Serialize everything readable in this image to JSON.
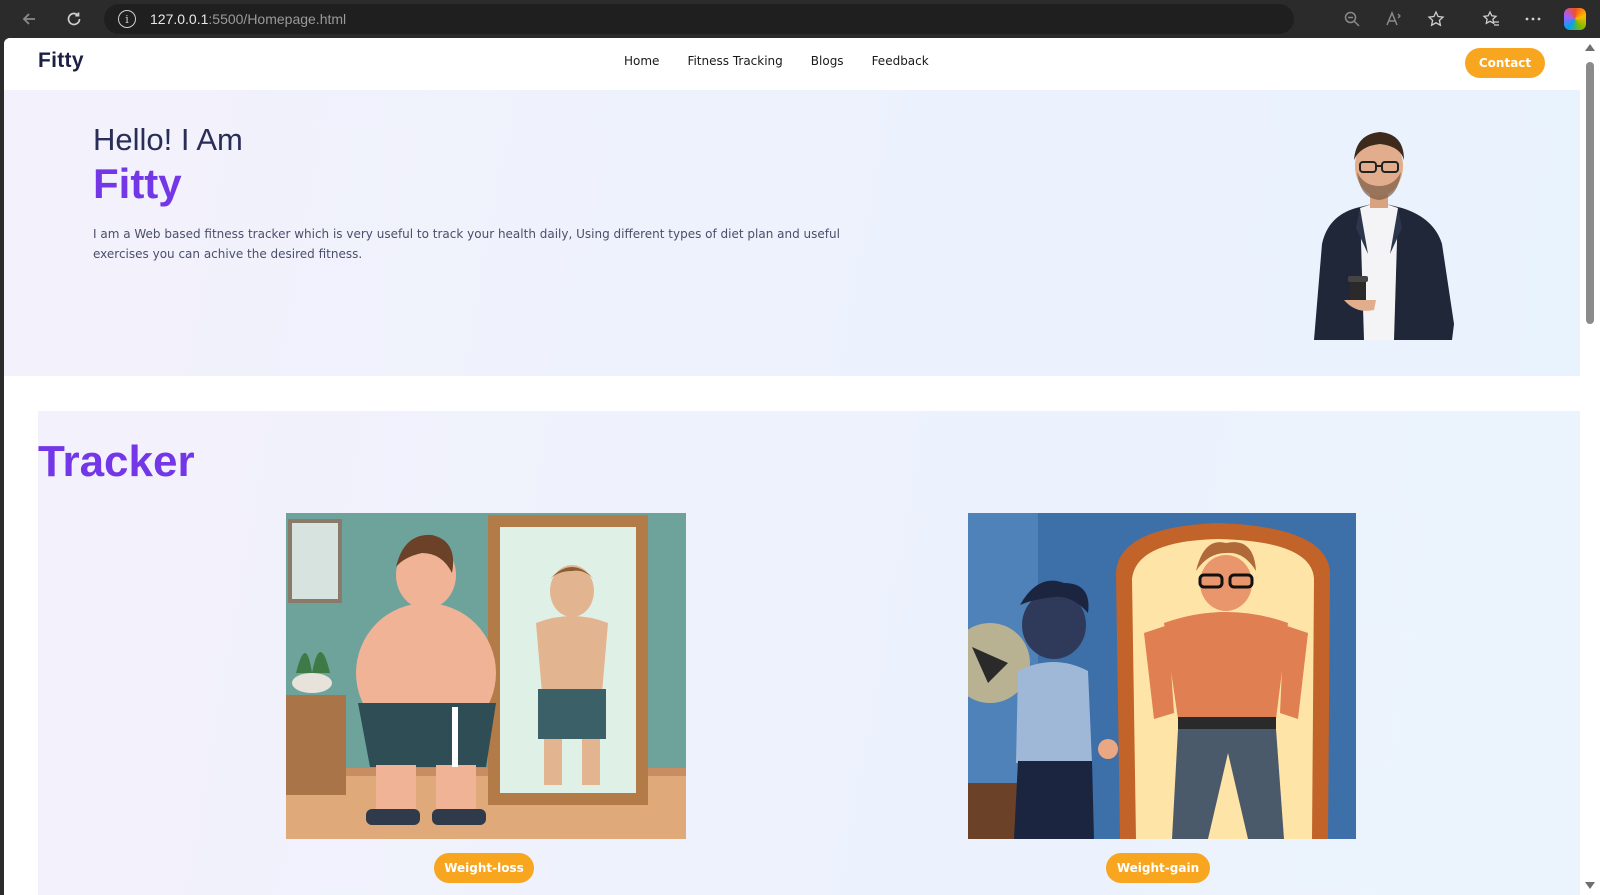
{
  "browser": {
    "url_host": "127.0.0.1",
    "url_path": ":5500/Homepage.html",
    "info_glyph": "i"
  },
  "nav": {
    "brand": "Fitty",
    "items": [
      {
        "label": "Home"
      },
      {
        "label": "Fitness Tracking"
      },
      {
        "label": "Blogs"
      },
      {
        "label": "Feedback"
      }
    ],
    "contact_label": "Contact"
  },
  "hero": {
    "greeting": "Hello! I Am",
    "name": "Fitty",
    "description": "I am a Web based fitness tracker which is very useful to track your health daily, Using different types of diet plan and useful exercises you can achive the desired fitness."
  },
  "tracker": {
    "title": "Tracker",
    "cards": [
      {
        "button_label": "Weight-loss"
      },
      {
        "button_label": "Weight-gain"
      }
    ]
  },
  "colors": {
    "accent": "#7337e8",
    "button": "#f8a520",
    "heading": "#2a2d55"
  }
}
